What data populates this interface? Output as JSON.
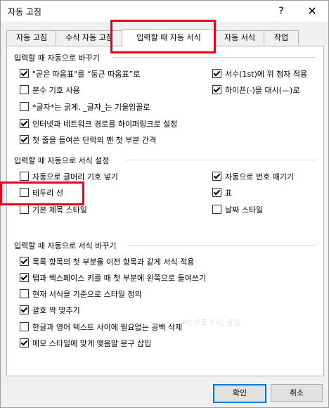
{
  "window": {
    "title": "자동 고침",
    "help": "?",
    "close": "✕"
  },
  "tabs": [
    {
      "label": "자동 고침"
    },
    {
      "label": "수식 자동 고침"
    },
    {
      "label": "입력할 때 자동 서식"
    },
    {
      "label": "자동 서식"
    },
    {
      "label": "작업"
    }
  ],
  "groups": {
    "replace_as_you_type": {
      "title": "입력할 때 자동으로 바꾸기",
      "left": [
        {
          "label": "\"곧은 따옴표\"를 “둥근 따옴표”로",
          "checked": true
        },
        {
          "label": "분수 기호 사용",
          "checked": false
        },
        {
          "label": "*글자*는 굵게, _글자_는 기울임꼴로",
          "checked": false
        },
        {
          "label": "인터넷과 네트워크 경로를 하이퍼링크로 설정",
          "checked": true
        },
        {
          "label": "첫 줄을 들여쓴 단락의 맨 첫 부분 간격",
          "checked": true
        }
      ],
      "right": [
        {
          "label": "서수(1st)에 위 첨자 적용",
          "checked": true
        },
        {
          "label": "하이픈(-)을 대시(—)로",
          "checked": true
        }
      ]
    },
    "apply_as_you_type": {
      "title": "입력할 때 자동으로 서식 설정",
      "left": [
        {
          "label": "자동으로 글머리 기호 넣기",
          "checked": false
        },
        {
          "label": "테두리 선",
          "checked": false
        },
        {
          "label": "기본 제목 스타일",
          "checked": false
        }
      ],
      "right": [
        {
          "label": "자동으로 번호 매기기",
          "checked": true
        },
        {
          "label": "표",
          "checked": true
        },
        {
          "label": "날짜 스타일",
          "checked": false
        }
      ]
    },
    "automatically_as_you_type": {
      "title": "입력할 때 자동으로 서식 바꾸기",
      "items": [
        {
          "label": "목록 항목의 첫 부분을 이전 항목과 같게 서식 적용",
          "checked": true
        },
        {
          "label": "탭과 백스페이스 키를 때 첫 부분에 왼쪽으로 들여쓰기",
          "checked": true
        },
        {
          "label": "현재 서식을 기준으로 스타일 정의",
          "checked": false
        },
        {
          "label": "괄호 짝 맞추기",
          "checked": true
        },
        {
          "label": "한글과 영어 텍스트 사이에 필요없는 공백 삭제",
          "checked": false
        },
        {
          "label": "메모 스타일에 맞게 맺음말 문구 삽입",
          "checked": true
        }
      ]
    }
  },
  "buttons": {
    "ok": "확인",
    "cancel": "취소"
  },
  "watermark": "PC 무료 수리, 꿀팁",
  "colors": {
    "highlight": "#e8001c",
    "focus": "#0078d7"
  }
}
